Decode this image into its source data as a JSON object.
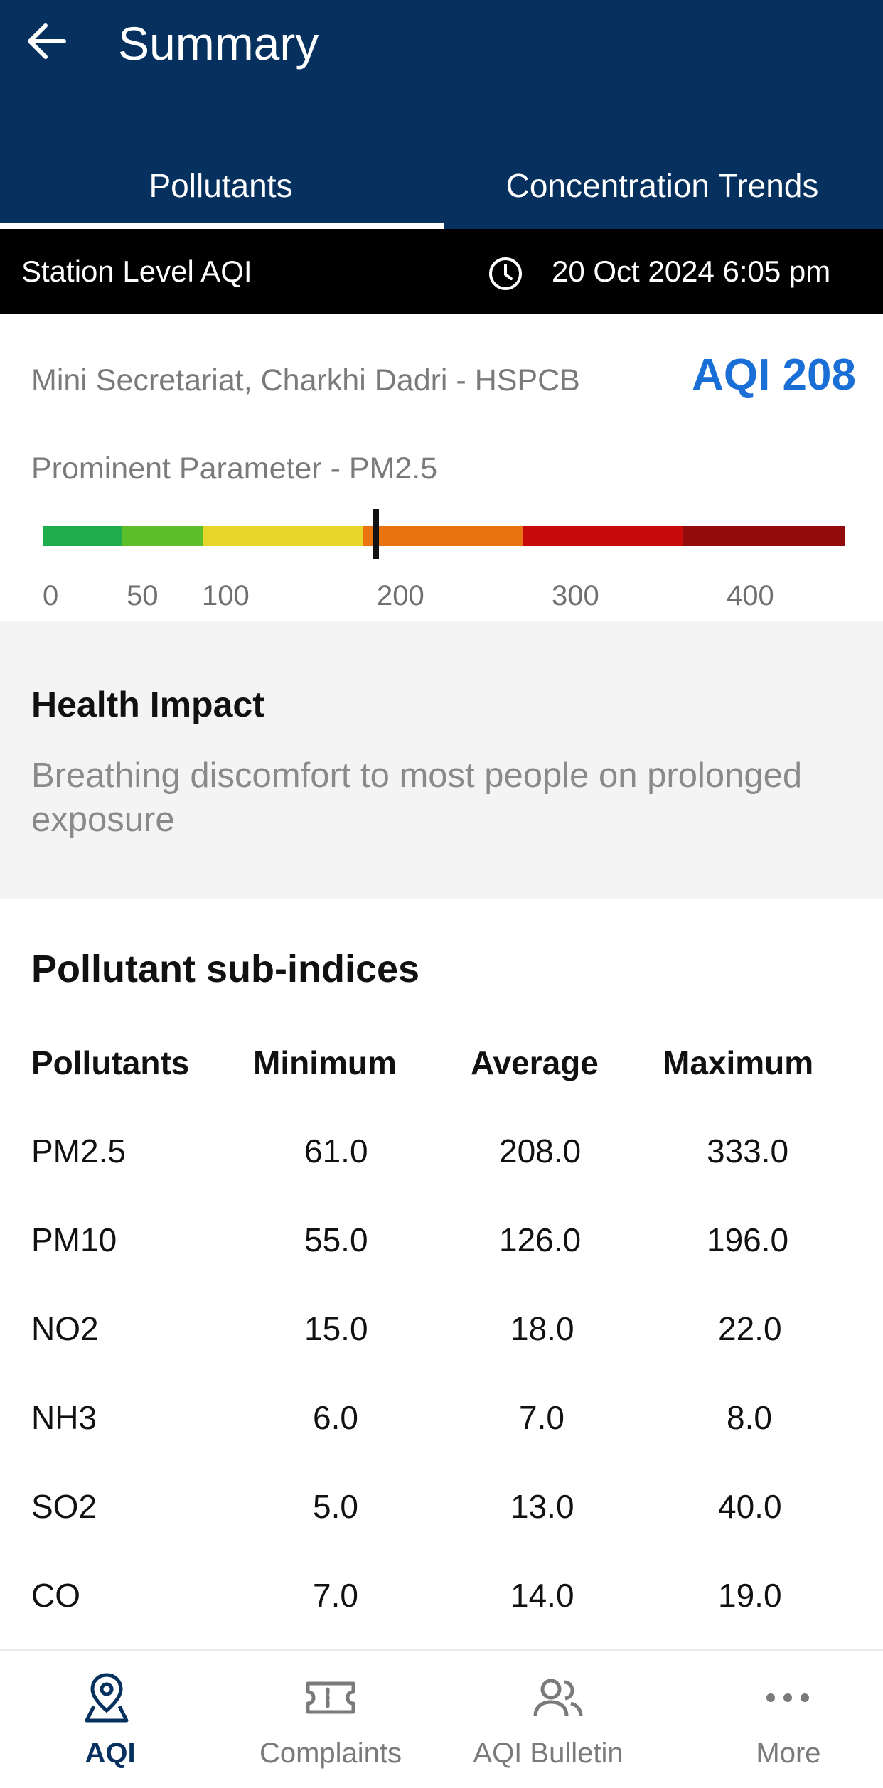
{
  "header": {
    "title": "Summary"
  },
  "tabs": [
    {
      "label": "Pollutants",
      "active": true
    },
    {
      "label": "Concentration Trends",
      "active": false
    }
  ],
  "station_bar": {
    "label": "Station Level AQI",
    "timestamp": "20 Oct 2024 6:05 pm"
  },
  "station": {
    "name": "Mini Secretariat, Charkhi Dadri - HSPCB",
    "prominent": "Prominent Parameter - PM2.5",
    "aqi_text": "AQI 208",
    "aqi": 208
  },
  "aqi_scale": {
    "ticks": [
      "0",
      "50",
      "100",
      "200",
      "300",
      "400"
    ],
    "marker_value": 208,
    "colors": [
      "#1fae4b",
      "#5cbf2a",
      "#e6d62a",
      "#e8730f",
      "#c90a0a",
      "#940b0b"
    ]
  },
  "health": {
    "title": "Health Impact",
    "text": "Breathing discomfort to most people on prolonged exposure"
  },
  "sub_indices": {
    "title": "Pollutant sub-indices",
    "columns": [
      "Pollutants",
      "Minimum",
      "Average",
      "Maximum"
    ],
    "rows": [
      [
        "PM2.5",
        "61.0",
        "208.0",
        "333.0"
      ],
      [
        "PM10",
        "55.0",
        "126.0",
        "196.0"
      ],
      [
        "NO2",
        "15.0",
        "18.0",
        "22.0"
      ],
      [
        "NH3",
        "6.0",
        "7.0",
        "8.0"
      ],
      [
        "SO2",
        "5.0",
        "13.0",
        "40.0"
      ],
      [
        "CO",
        "7.0",
        "14.0",
        "19.0"
      ]
    ]
  },
  "bottom_nav": [
    {
      "label": "AQI",
      "icon": "map-pin-icon",
      "active": true
    },
    {
      "label": "Complaints",
      "icon": "ticket-icon",
      "active": false
    },
    {
      "label": "AQI Bulletin",
      "icon": "users-icon",
      "active": false
    },
    {
      "label": "More",
      "icon": "more-dots-icon",
      "active": false
    }
  ],
  "colors": {
    "primary": "#06305e",
    "accent": "#1a6fd6"
  }
}
